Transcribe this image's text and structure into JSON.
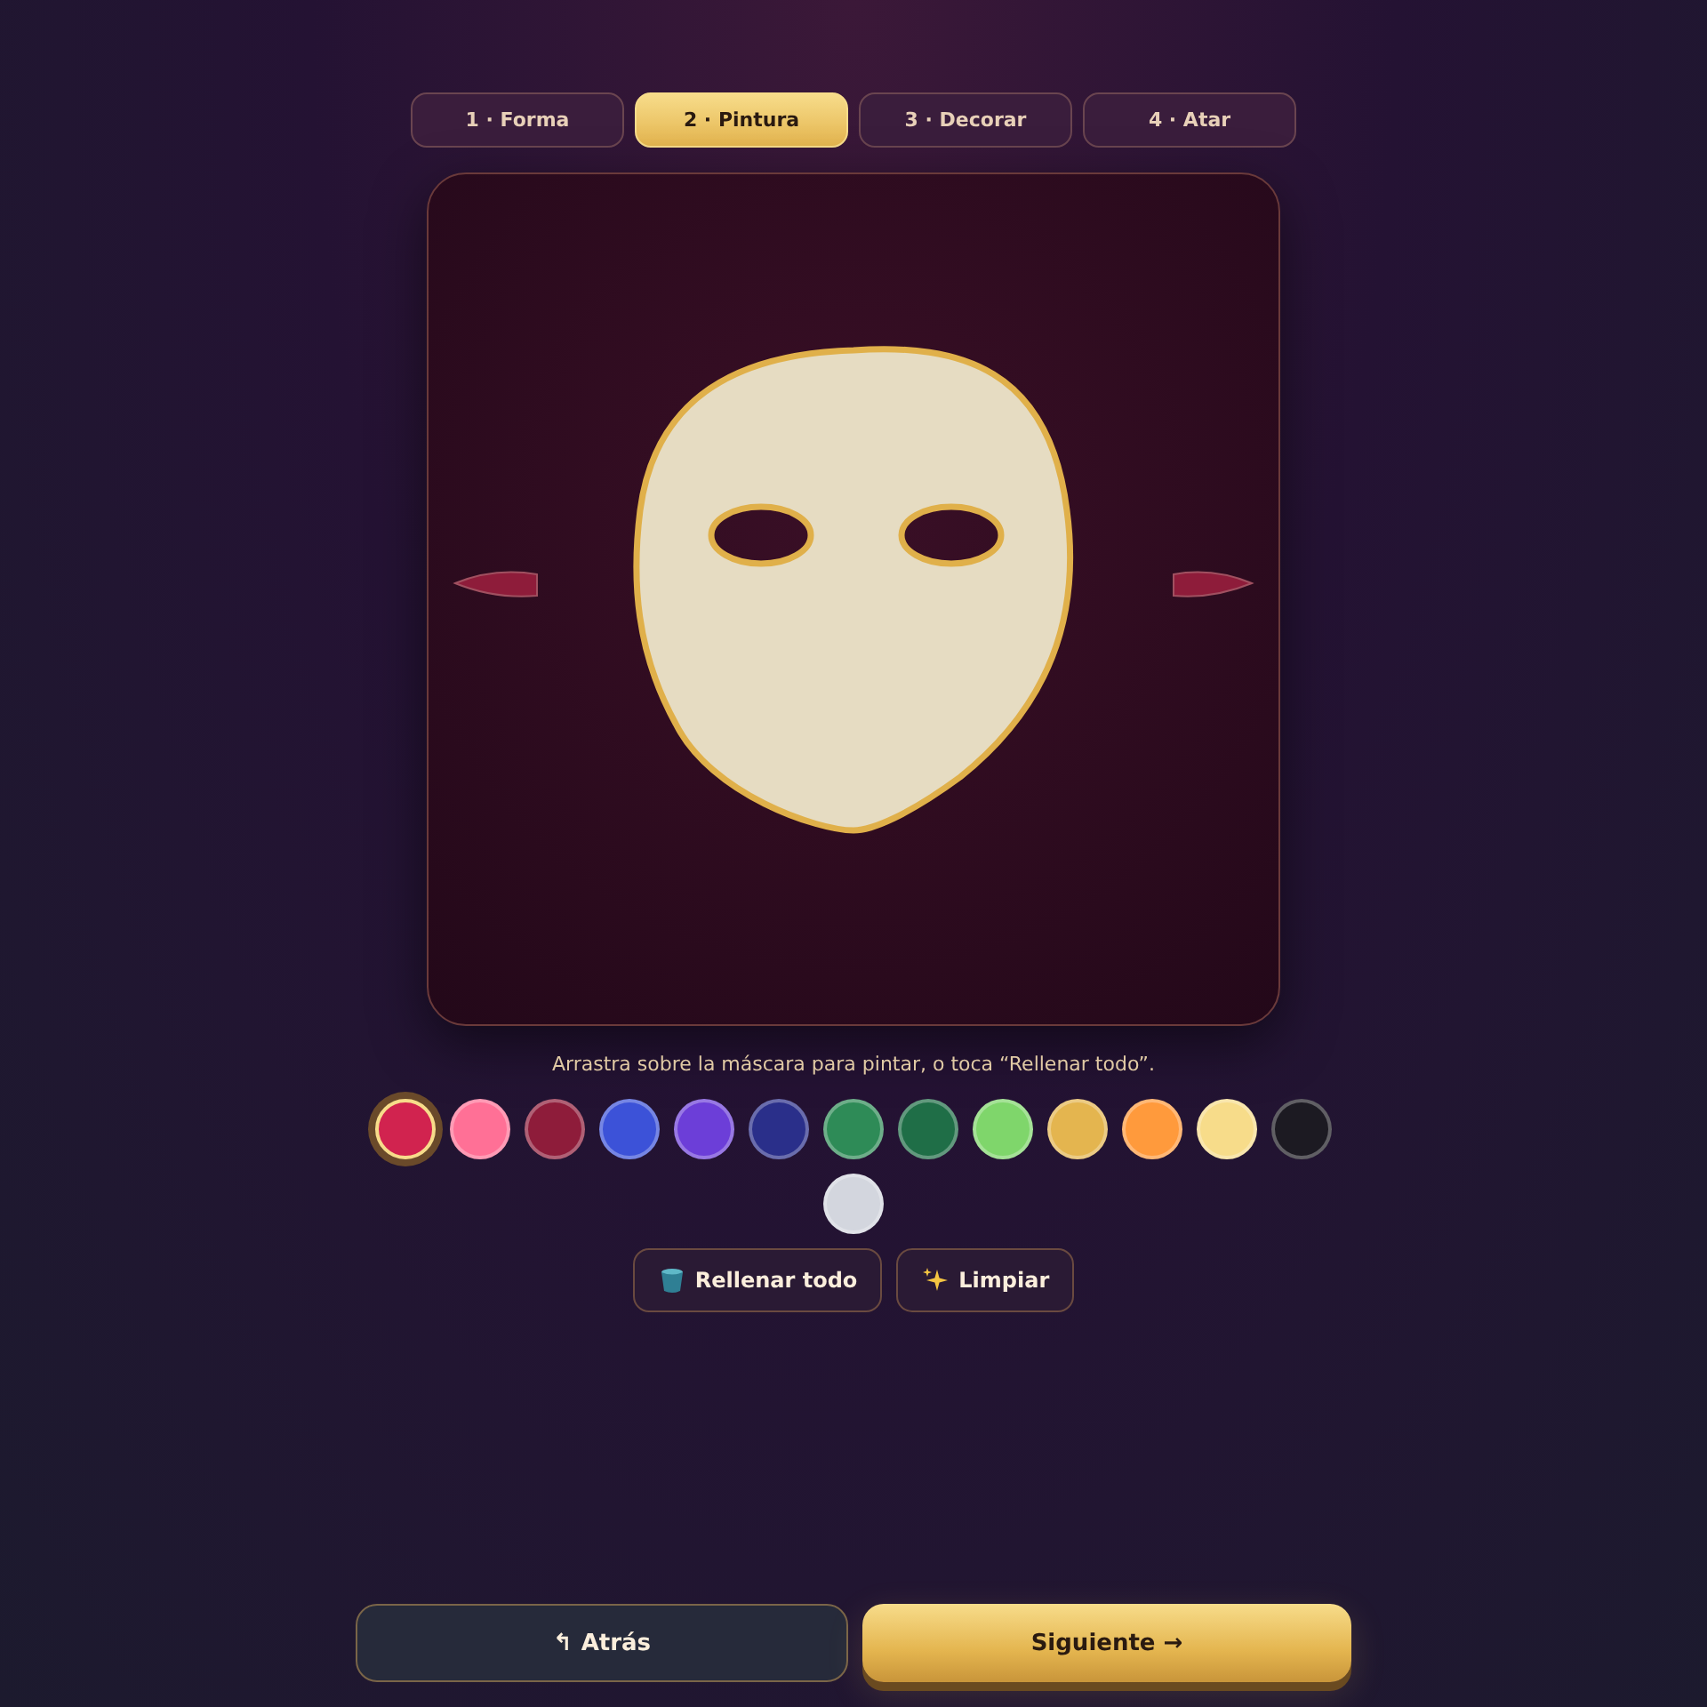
{
  "steps": [
    {
      "label": "1 · Forma",
      "selected": false
    },
    {
      "label": "2 · Pintura",
      "selected": true
    },
    {
      "label": "3 · Decorar",
      "selected": false
    },
    {
      "label": "4 · Atar",
      "selected": false
    }
  ],
  "hint": "Arrastra sobre la máscara para pintar, o toca “Rellenar todo”.",
  "swatches": [
    {
      "color": "#d1234f",
      "selected": true
    },
    {
      "color": "#ff7096",
      "selected": false
    },
    {
      "color": "#8e1c3a",
      "selected": false
    },
    {
      "color": "#3c52d8",
      "selected": false
    },
    {
      "color": "#6c3ed8",
      "selected": false
    },
    {
      "color": "#2a2f8a",
      "selected": false
    },
    {
      "color": "#2e8b57",
      "selected": false
    },
    {
      "color": "#1f6e47",
      "selected": false
    },
    {
      "color": "#7fd66b",
      "selected": false
    },
    {
      "color": "#e4b54f",
      "selected": false
    },
    {
      "color": "#ff9a3c",
      "selected": false
    },
    {
      "color": "#f7dc8a",
      "selected": false
    },
    {
      "color": "#1c1a22",
      "selected": false
    },
    {
      "color": "#d3d6de",
      "selected": false
    }
  ],
  "tools": [
    {
      "kind": "fill",
      "label": "Rellenar todo"
    },
    {
      "kind": "clear",
      "label": "Limpiar"
    }
  ],
  "back": {
    "icon": "↰",
    "label": "Atrás"
  },
  "next": {
    "label": "Siguiente →"
  }
}
